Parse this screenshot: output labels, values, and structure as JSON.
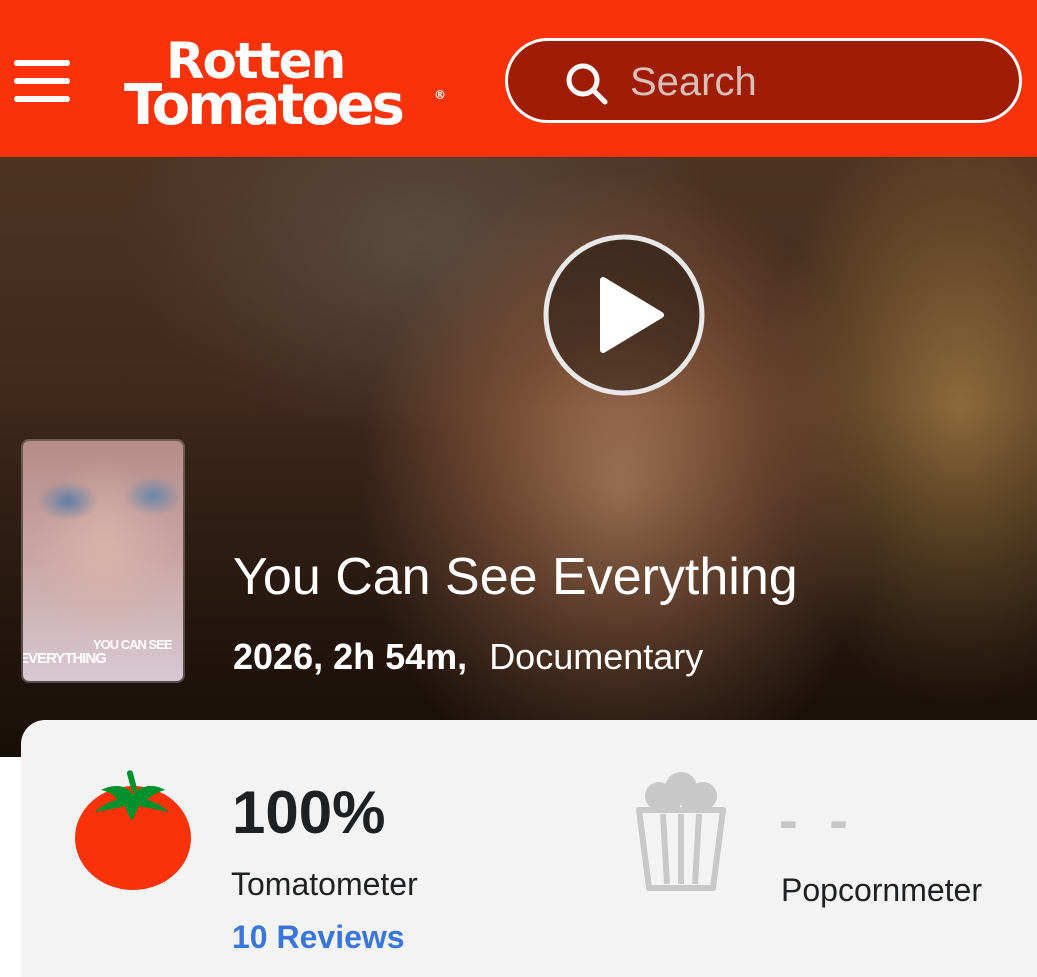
{
  "header": {
    "logo_line1": "Rotten",
    "logo_line2": "Tomatoes",
    "logo_reg": "®",
    "search_placeholder": "Search",
    "brand_color": "#fa320a"
  },
  "hero": {
    "title": "You Can See Everything",
    "year_runtime": "2026, 2h 54m,",
    "genre": "Documentary",
    "poster_text_top": "YOU CAN SEE",
    "poster_text_bottom": "EVERYTHING",
    "play_icon": "play-icon"
  },
  "scores": {
    "tomatometer": {
      "score": "100%",
      "label": "Tomatometer",
      "reviews": "10 Reviews",
      "icon": "tomato-icon"
    },
    "popcornmeter": {
      "score": "- -",
      "label": "Popcornmeter",
      "icon": "popcorn-icon"
    }
  }
}
